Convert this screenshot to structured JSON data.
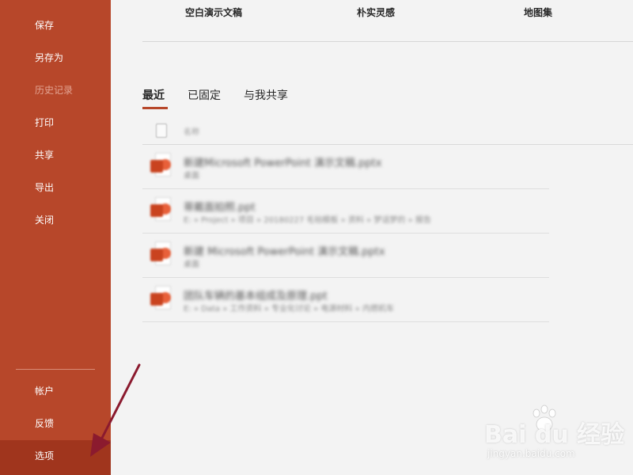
{
  "sidebar": {
    "items": [
      {
        "label": "保存"
      },
      {
        "label": "另存为"
      },
      {
        "label": "历史记录"
      },
      {
        "label": "打印"
      },
      {
        "label": "共享"
      },
      {
        "label": "导出"
      },
      {
        "label": "关闭"
      }
    ],
    "bottom_items": [
      {
        "label": "帐户"
      },
      {
        "label": "反馈"
      },
      {
        "label": "选项"
      }
    ]
  },
  "templates": [
    {
      "title": "空白演示文稿"
    },
    {
      "title": "朴实灵感"
    },
    {
      "title": "地图集"
    }
  ],
  "tabs": [
    {
      "label": "最近"
    },
    {
      "label": "已固定"
    },
    {
      "label": "与我共享"
    }
  ],
  "file_list": {
    "header_label": "名称",
    "files": [
      {
        "name": "新建Microsoft PowerPoint 演示文稿.pptx",
        "path": "桌面"
      },
      {
        "name": "蒂戴面拍照.ppt",
        "path": "E: » Project » 项目 » 20180227 毛毡模板 » 资料 » 梦话梦的 » 报告"
      },
      {
        "name": "新建 Microsoft PowerPoint 演示文稿.pptx",
        "path": "桌面"
      },
      {
        "name": "团队车辆的基本组成及原理.ppt",
        "path": "E: » Data » 工作资料 » 专业化讨论 » 电源材料 » 内燃机车"
      }
    ]
  },
  "watermark": {
    "brand": "Bai du 经验",
    "url": "jingyan.baidu.com"
  },
  "colors": {
    "sidebar": "#b7472a",
    "sidebar_selected": "#a0351d",
    "accent": "#b7472a",
    "arrow": "#8b1a2e"
  }
}
